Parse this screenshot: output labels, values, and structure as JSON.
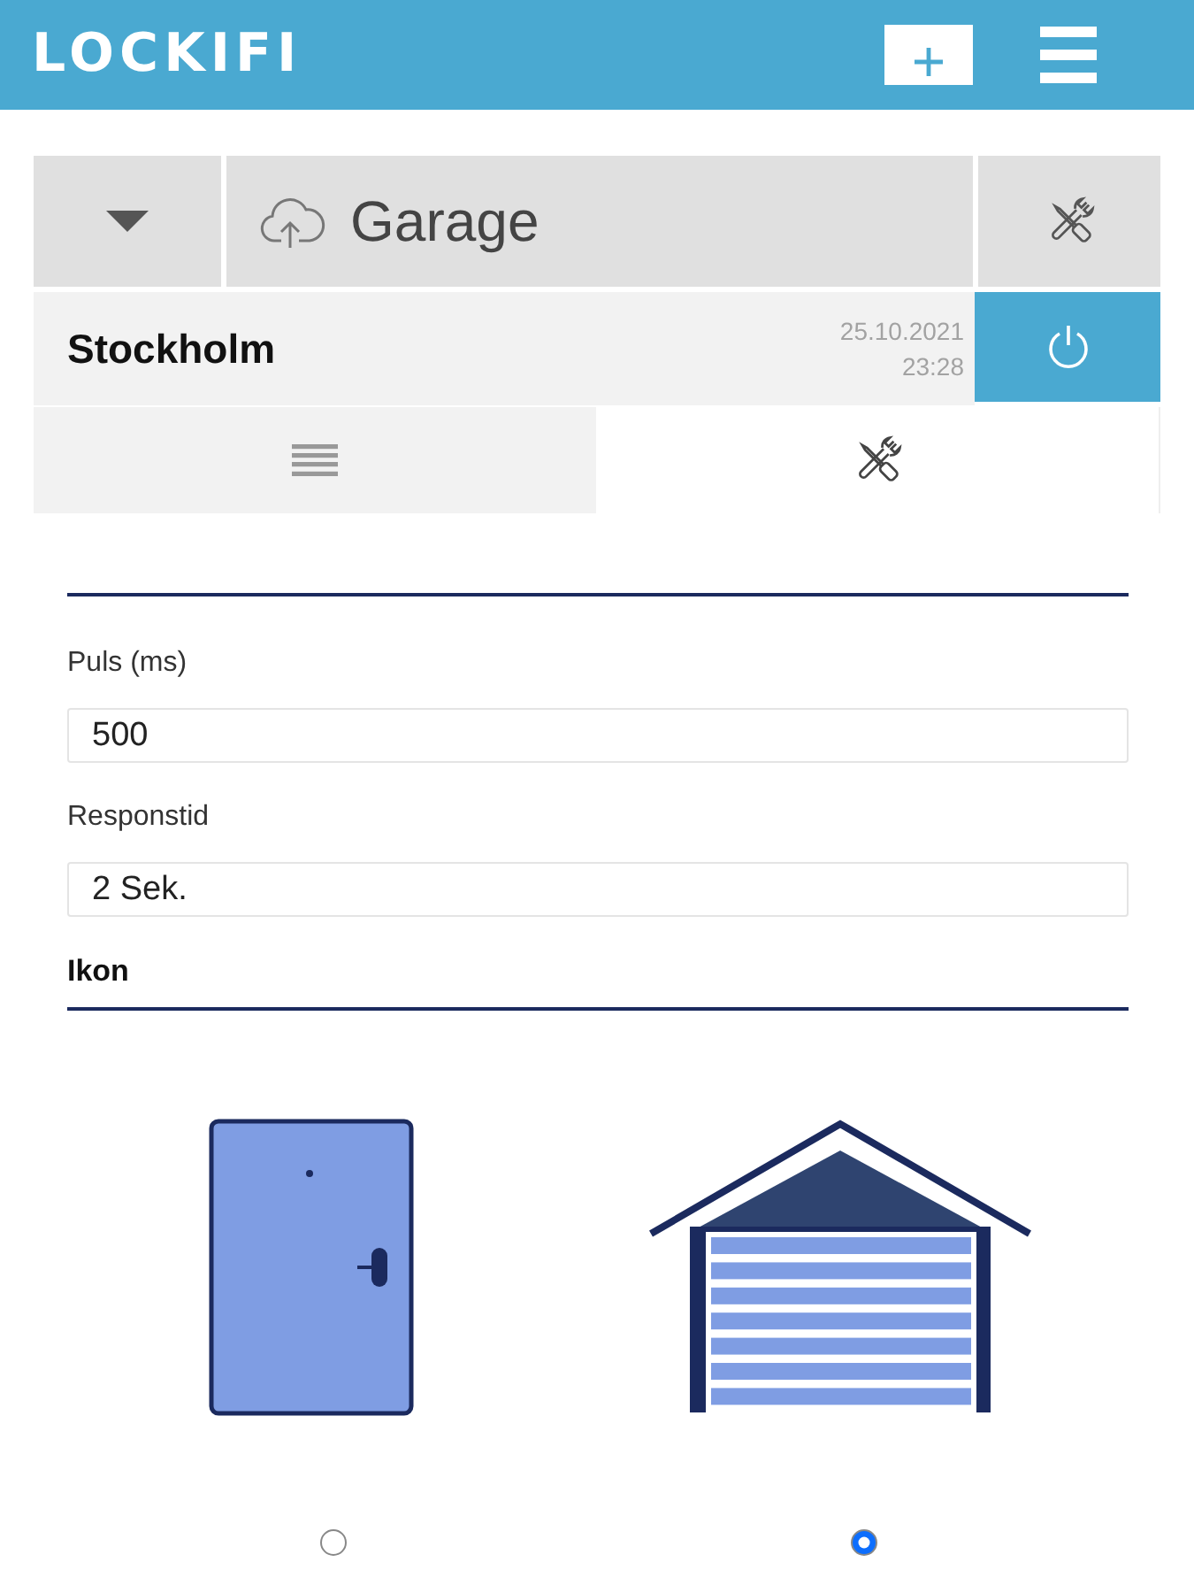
{
  "header": {
    "logo": "LOCKIFI"
  },
  "device": {
    "name": "Garage",
    "location": "Stockholm",
    "date": "25.10.2021",
    "time": "23:28"
  },
  "tabs": [
    {
      "kind": "list",
      "selected": false
    },
    {
      "kind": "tools",
      "selected": true
    }
  ],
  "settings": {
    "fields": [
      {
        "label": "Puls (ms)",
        "value": "500"
      },
      {
        "label": "Responstid",
        "value": "2 Sek."
      }
    ],
    "icon_section": {
      "heading": "Ikon",
      "options": [
        {
          "kind": "door",
          "selected": false
        },
        {
          "kind": "garage",
          "selected": true
        }
      ]
    }
  }
}
